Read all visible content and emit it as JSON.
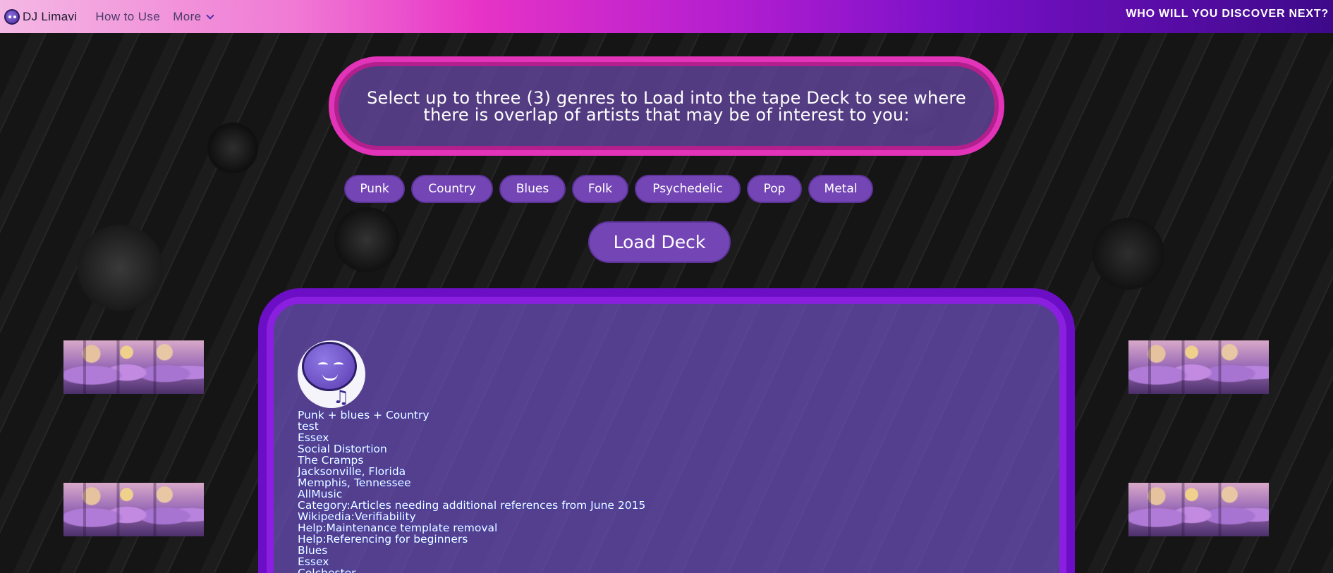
{
  "nav": {
    "brand": "DJ Limavi",
    "links": [
      {
        "label": "How to Use"
      },
      {
        "label": "More",
        "icon": "chevron-down-icon"
      }
    ],
    "tagline": "WHO WILL YOU DISCOVER NEXT?"
  },
  "prompt": {
    "line1": "Select up to three (3) genres to Load into the tape Deck to see where",
    "line2": "there is overlap of artists that may be of interest to you:"
  },
  "genres": [
    "Punk",
    "Country",
    "Blues",
    "Folk",
    "Psychedelic",
    "Pop",
    "Metal"
  ],
  "load_button": "Load Deck",
  "results": {
    "mascot_icon": "dj-mascot-icon",
    "lines": [
      "Punk + blues + Country",
      "test",
      "Essex",
      "Social Distortion",
      "The Cramps",
      "Jacksonville, Florida",
      "Memphis, Tennessee",
      "AllMusic",
      "Category:Articles needing additional references from June 2015",
      "Wikipedia:Verifiability",
      "Help:Maintenance template removal",
      "Help:Referencing for beginners",
      "Blues",
      "Essex",
      "Colchester"
    ]
  },
  "colors": {
    "accent_pink": "#e333b9",
    "accent_purple": "#6d0ec7",
    "chip_bg": "#7445b5"
  }
}
